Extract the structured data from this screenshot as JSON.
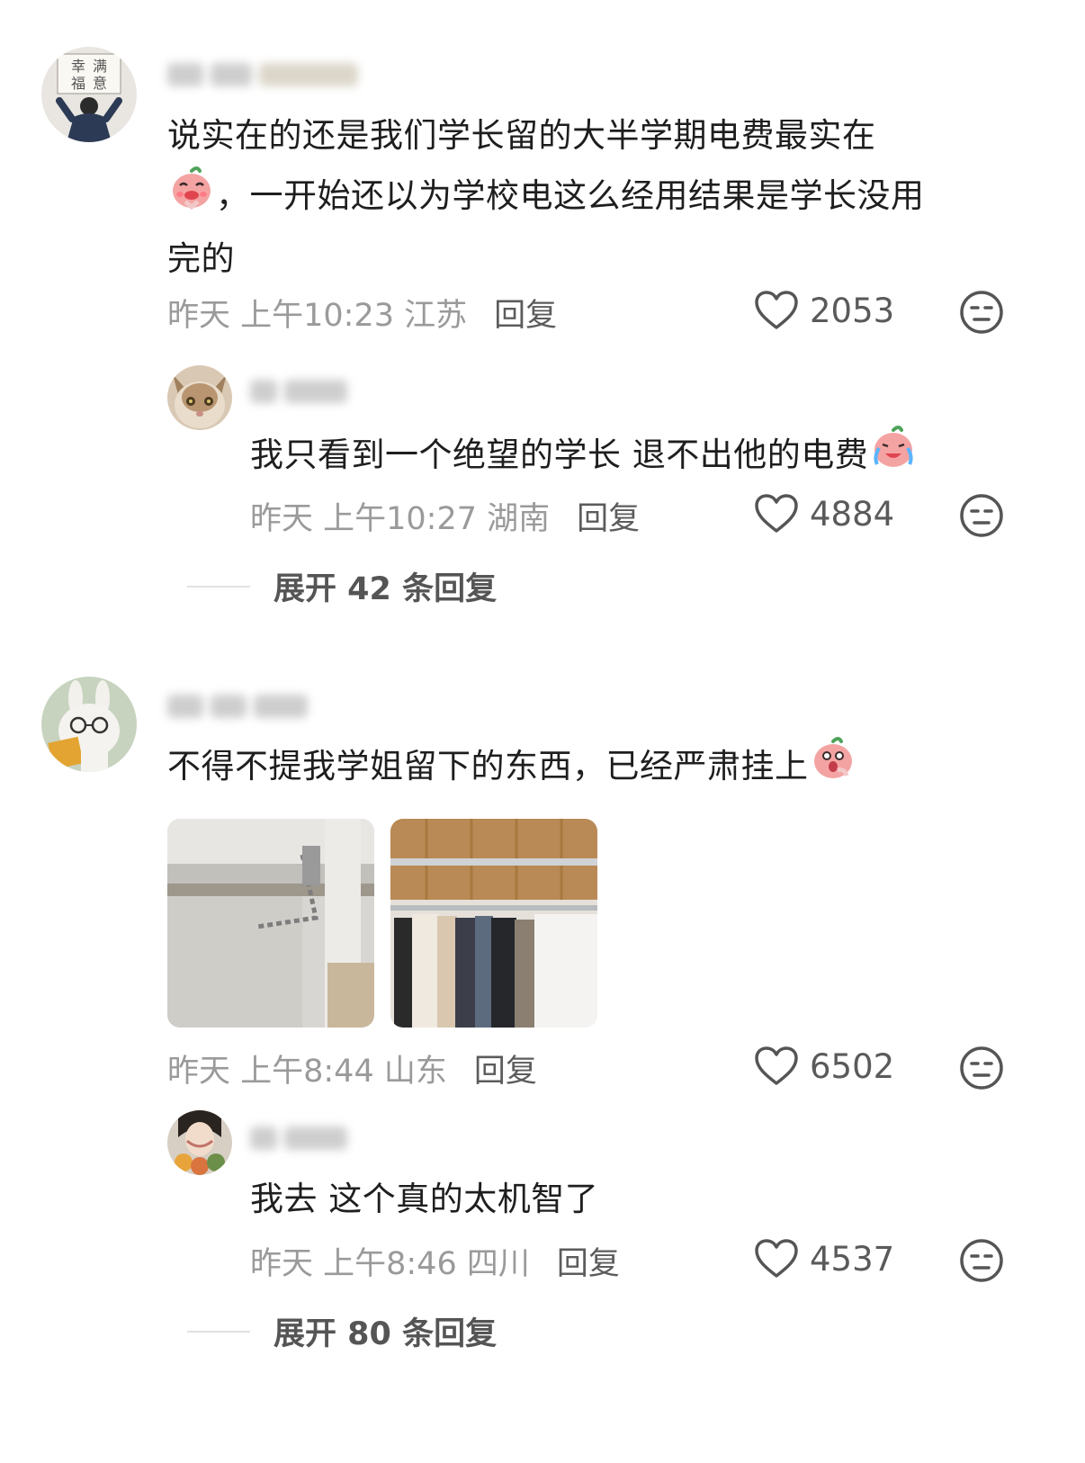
{
  "comments": [
    {
      "location_time": "昨天 上午10:23 江苏",
      "text_line1": "说实在的还是我们学长留的大半学期电费最实在",
      "text_line2": "，一开始还以为学校电这么经用结果是学长没用",
      "text_line3": "完的",
      "reply_label": "回复",
      "likes": "2053",
      "avatar_text": [
        "幸",
        "满",
        "福",
        "意"
      ],
      "replies": [
        {
          "text": "我只看到一个绝望的学长 退不出他的电费",
          "location_time": "昨天 上午10:27 湖南",
          "reply_label": "回复",
          "likes": "4884"
        }
      ],
      "expand_label": "展开 42 条回复"
    },
    {
      "text": "不得不提我学姐留下的东西，已经严肃挂上",
      "location_time": "昨天 上午8:44 山东",
      "reply_label": "回复",
      "likes": "6502",
      "replies": [
        {
          "text": "我去 这个真的太机智了",
          "location_time": "昨天 上午8:46 四川",
          "reply_label": "回复",
          "likes": "4537"
        }
      ],
      "expand_label": "展开 80 条回复"
    }
  ],
  "icons": {
    "like": "heart-outline-icon",
    "dislike": "meh-face-icon",
    "emoji": "peach-sticker-icon"
  },
  "colors": {
    "meta": "#9a9a9a",
    "reply": "#5c5c5c",
    "text": "#1e1e1e"
  }
}
